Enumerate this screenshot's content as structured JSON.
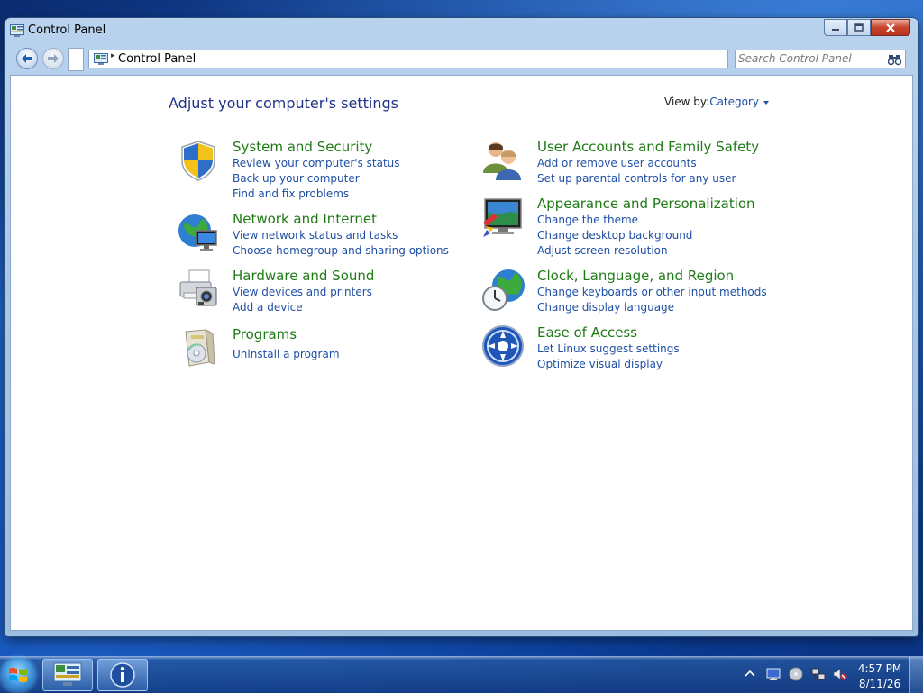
{
  "window": {
    "title": "Control Panel",
    "buttons": {
      "minimize": "minimize",
      "maximize": "maximize",
      "close": "close"
    }
  },
  "navigation": {
    "address": "Control Panel",
    "search_placeholder": "Search Control Panel"
  },
  "main": {
    "heading": "Adjust your computer's settings",
    "view_by_label": "View by:",
    "view_by_value": "Category",
    "categories": [
      {
        "title": "System and Security",
        "icon": "shield-icon",
        "links": [
          "Review your computer's status",
          "Back up your computer",
          "Find and fix problems"
        ]
      },
      {
        "title": "Network and Internet",
        "icon": "globe-network-icon",
        "links": [
          "View network status and tasks",
          "Choose homegroup and sharing options"
        ]
      },
      {
        "title": "Hardware and Sound",
        "icon": "printer-camera-icon",
        "links": [
          "View devices and printers",
          "Add a device"
        ]
      },
      {
        "title": "Programs",
        "icon": "programs-box-icon",
        "links": [
          "Uninstall a program"
        ]
      },
      {
        "title": "User Accounts and Family Safety",
        "icon": "users-icon",
        "links": [
          "Add or remove user accounts",
          "Set up parental controls for any user"
        ]
      },
      {
        "title": "Appearance and Personalization",
        "icon": "monitor-palette-icon",
        "links": [
          "Change the theme",
          "Change desktop background",
          "Adjust screen resolution"
        ]
      },
      {
        "title": "Clock, Language, and Region",
        "icon": "clock-globe-icon",
        "links": [
          "Change keyboards or other input methods",
          "Change display language"
        ]
      },
      {
        "title": "Ease of Access",
        "icon": "ease-of-access-icon",
        "links": [
          "Let Linux suggest settings",
          "Optimize visual display"
        ]
      }
    ]
  },
  "taskbar": {
    "clock_time": "4:57 PM",
    "clock_date": "8/11/26",
    "tray_icons": [
      "show-hidden-icons-chevron-icon",
      "display-icon",
      "disc-icon",
      "network-icon",
      "volume-muted-icon"
    ]
  },
  "colors": {
    "link": "#1e4fa5",
    "category_title": "#1f7a16",
    "heading": "#1e3287"
  }
}
